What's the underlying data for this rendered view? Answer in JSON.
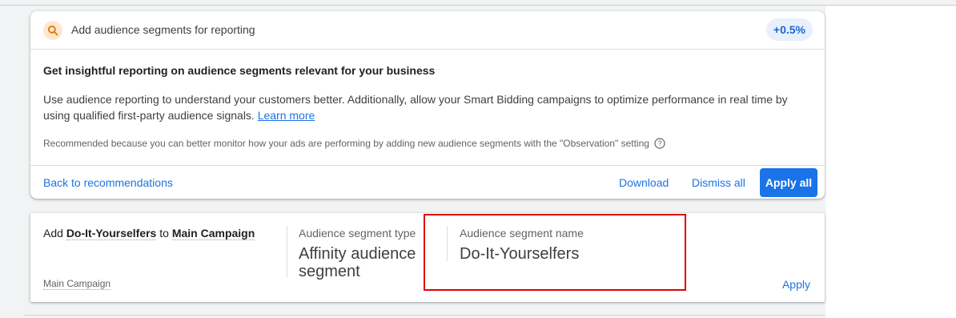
{
  "recommendation": {
    "header_title": "Add audience segments for reporting",
    "badge": "+0.5%",
    "body_title": "Get insightful reporting on audience segments relevant for your business",
    "description": "Use audience reporting to understand your customers better. Additionally, allow your Smart Bidding campaigns to optimize performance in real time by using qualified first-party audience signals.",
    "learn_more": "Learn more",
    "reason": "Recommended because you can better monitor how your ads are performing by adding new audience segments with the \"Observation\" setting",
    "back_label": "Back to recommendations",
    "download_label": "Download",
    "dismiss_label": "Dismiss all",
    "apply_all_label": "Apply all",
    "icon": "search-icon"
  },
  "item": {
    "prefix": "Add",
    "segment": "Do-It-Yourselfers",
    "connector": "to",
    "campaign": "Main Campaign",
    "campaign_sub": "Main Campaign",
    "type_label": "Audience segment type",
    "type_value": "Affinity audience segment",
    "name_label": "Audience segment name",
    "name_value": "Do-It-Yourselfers",
    "apply_label": "Apply"
  },
  "colors": {
    "accent": "#1a73e8",
    "highlight_box": "#e00000",
    "icon_bg": "#fce8cf",
    "icon_fg": "#e37400"
  }
}
